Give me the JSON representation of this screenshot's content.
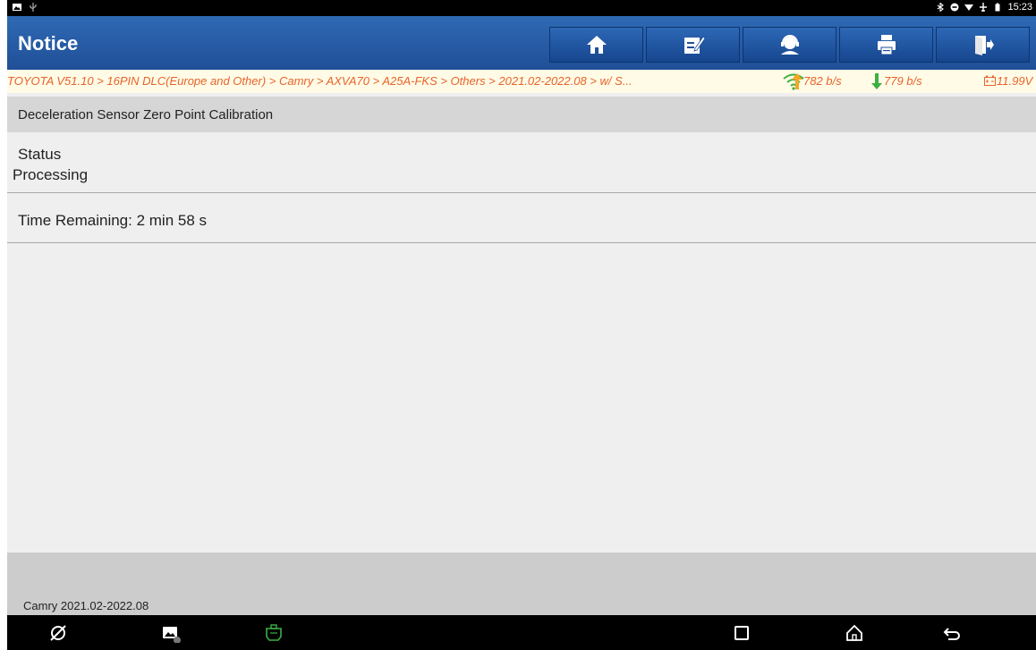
{
  "status_bar": {
    "time": "15:23"
  },
  "title_bar": {
    "title": "Notice",
    "buttons": [
      "home-icon",
      "edit-icon",
      "support-icon",
      "print-icon",
      "exit-icon"
    ]
  },
  "breadcrumb": {
    "path": "TOYOTA V51.10 > 16PIN DLC(Europe and Other) > Camry > AXVA70 > A25A-FKS > Others > 2021.02-2022.08 > w/ S...",
    "upload_rate": "782 b/s",
    "download_rate": "779 b/s",
    "voltage": "11.99V"
  },
  "content": {
    "heading": "Deceleration Sensor Zero Point Calibration",
    "status_label": "Status",
    "status_value": "Processing",
    "time_remaining": "Time Remaining: 2 min 58 s"
  },
  "footer": {
    "vehicle": "Camry 2021.02-2022.08"
  },
  "colors": {
    "title_bar": "#1f4f97",
    "breadcrumb_text": "#e8632b",
    "upload_arrow": "#f5a623",
    "download_arrow": "#3cb043",
    "wifi": "#3cb043"
  }
}
